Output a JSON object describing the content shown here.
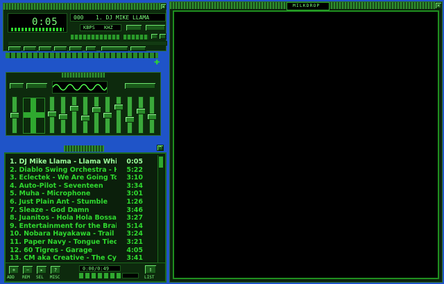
{
  "player": {
    "time": "0:05",
    "kbps": "000",
    "title_scroll": "1. DJ MIKE LLAMA",
    "kbps_unit": "KBPS",
    "khz_unit": "KHZ"
  },
  "eq": {},
  "playlist": {
    "tracks": [
      {
        "n": "1.",
        "title": "DJ Mike Llama - Llama Whippin' Intro",
        "dur": "0:05",
        "current": true
      },
      {
        "n": "2.",
        "title": "Diablo Swing Orchestra - Heroines",
        "dur": "5:22"
      },
      {
        "n": "3.",
        "title": "Eclectek - We Are Going To Eclecfu...",
        "dur": "3:10"
      },
      {
        "n": "4.",
        "title": "Auto-Pilot - Seventeen",
        "dur": "3:34"
      },
      {
        "n": "5.",
        "title": "Muha - Microphone",
        "dur": "3:01"
      },
      {
        "n": "6.",
        "title": "Just Plain Ant - Stumble",
        "dur": "1:26"
      },
      {
        "n": "7.",
        "title": "Sleaze - God Damn",
        "dur": "3:46"
      },
      {
        "n": "8.",
        "title": "Juanitos - Hola Hola Bossa Nova",
        "dur": "3:27"
      },
      {
        "n": "9.",
        "title": "Entertainment for the Braindead - ...",
        "dur": "5:14"
      },
      {
        "n": "10.",
        "title": "Nobara Hayakawa - Trail",
        "dur": "3:24"
      },
      {
        "n": "11.",
        "title": "Paper Navy - Tongue Tied",
        "dur": "3:21"
      },
      {
        "n": "12.",
        "title": "60 Tigres - Garage",
        "dur": "4:05"
      },
      {
        "n": "13.",
        "title": "CM aka Creative - The Cycle (Featu...",
        "dur": "3:41"
      }
    ],
    "time_readout": "0:00/0:49",
    "bottom_buttons": [
      "ADD",
      "REM",
      "SEL",
      "MISC"
    ],
    "list_button": "LIST"
  },
  "milkdrop": {
    "title": "MILKDROP"
  },
  "colors": {
    "accent": "#2fd82f",
    "bg": "#1f54c8",
    "panel": "#0a1a0a"
  }
}
